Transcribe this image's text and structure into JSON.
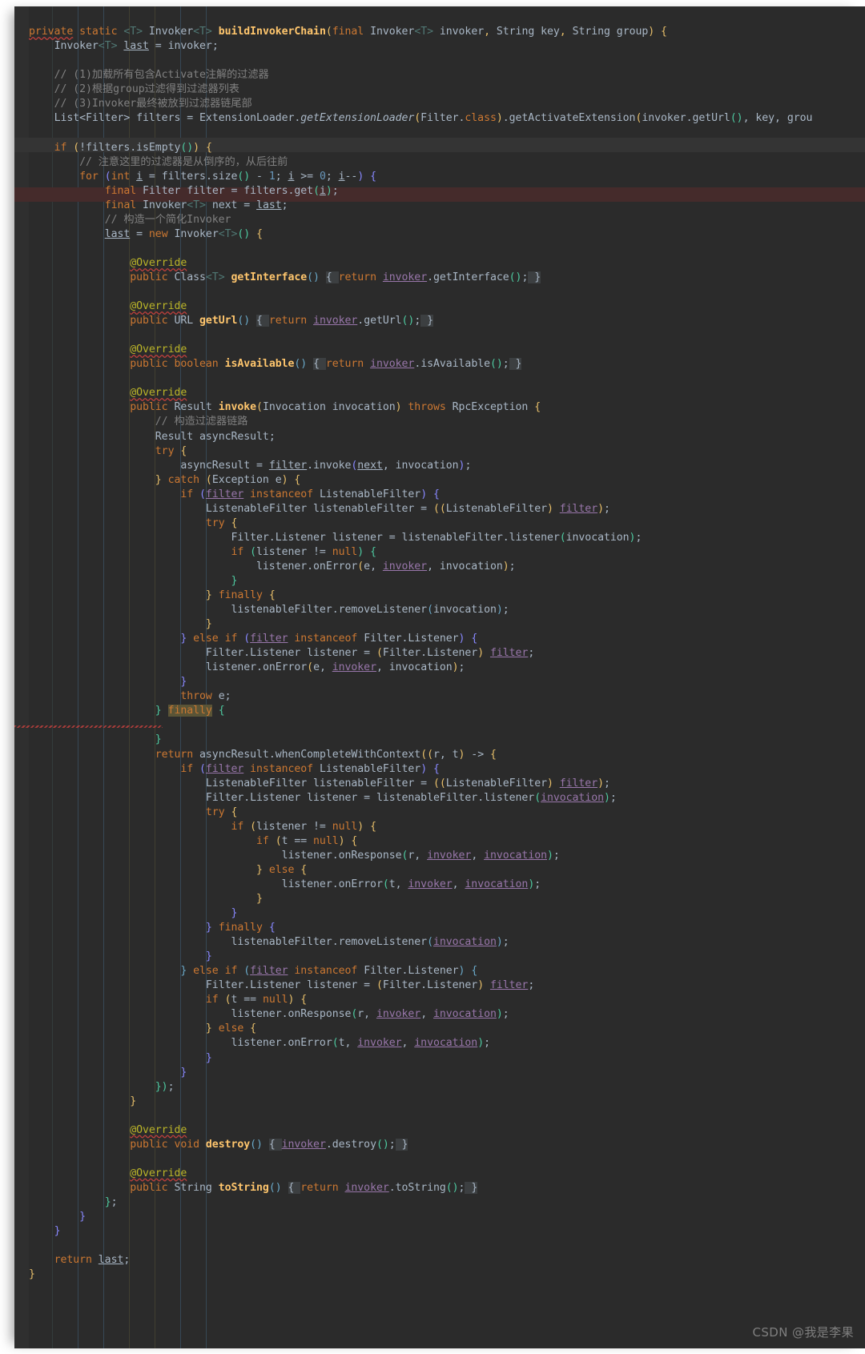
{
  "editor": {
    "language": "Java",
    "theme": "Darcula",
    "background_color": "#2b2b2b",
    "default_text_color": "#a9b7c6",
    "keyword_color": "#cc7832",
    "comment_color": "#808080",
    "annotation_color": "#bbb529",
    "field_color": "#9876aa",
    "method_color": "#ffc66d",
    "caret_line_color": "#452b2b",
    "search_match_color": "#5a5436"
  },
  "watermark": {
    "text": "CSDN @我是李果"
  },
  "code": {
    "truncated_right_edge": true,
    "lines": [
      "private static <T> Invoker<T> buildInvokerChain(final Invoker<T> invoker, String key, String group) {",
      "    Invoker<T> last = invoker;",
      "",
      "    // (1)加载所有包含Activate注解的过滤器",
      "    // (2)根据group过滤得到过滤器列表",
      "    // (3)Invoker最终被放到过滤器链尾部",
      "    List<Filter> filters = ExtensionLoader.getExtensionLoader(Filter.class).getActivateExtension(invoker.getUrl(), key, grou",
      "",
      "    if (!filters.isEmpty()) {",
      "        // 注意这里的过滤器是从倒序的，从后往前",
      "        for (int i = filters.size() - 1; i >= 0; i--) {",
      "            final Filter filter = filters.get(i);",
      "            final Invoker<T> next = last;",
      "            // 构造一个简化Invoker",
      "            last = new Invoker<T>() {",
      "",
      "                @Override",
      "                public Class<T> getInterface() { return invoker.getInterface(); }",
      "",
      "                @Override",
      "                public URL getUrl() { return invoker.getUrl(); }",
      "",
      "                @Override",
      "                public boolean isAvailable() { return invoker.isAvailable(); }",
      "",
      "                @Override",
      "                public Result invoke(Invocation invocation) throws RpcException {",
      "                    // 构造过滤器链路",
      "                    Result asyncResult;",
      "                    try {",
      "                        asyncResult = filter.invoke(next, invocation);",
      "                    } catch (Exception e) {",
      "                        if (filter instanceof ListenableFilter) {",
      "                            ListenableFilter listenableFilter = ((ListenableFilter) filter);",
      "                            try {",
      "                                Filter.Listener listener = listenableFilter.listener(invocation);",
      "                                if (listener != null) {",
      "                                    listener.onError(e, invoker, invocation);",
      "                                }",
      "                            } finally {",
      "                                listenableFilter.removeListener(invocation);",
      "                            }",
      "                        } else if (filter instanceof Filter.Listener) {",
      "                            Filter.Listener listener = (Filter.Listener) filter;",
      "                            listener.onError(e, invoker, invocation);",
      "                        }",
      "                        throw e;",
      "                    } finally {",
      "",
      "                    }",
      "                    return asyncResult.whenCompleteWithContext((r, t) -> {",
      "                        if (filter instanceof ListenableFilter) {",
      "                            ListenableFilter listenableFilter = ((ListenableFilter) filter);",
      "                            Filter.Listener listener = listenableFilter.listener(invocation);",
      "                            try {",
      "                                if (listener != null) {",
      "                                    if (t == null) {",
      "                                        listener.onResponse(r, invoker, invocation);",
      "                                    } else {",
      "                                        listener.onError(t, invoker, invocation);",
      "                                    }",
      "                                }",
      "                            } finally {",
      "                                listenableFilter.removeListener(invocation);",
      "                            }",
      "                        } else if (filter instanceof Filter.Listener) {",
      "                            Filter.Listener listener = (Filter.Listener) filter;",
      "                            if (t == null) {",
      "                                listener.onResponse(r, invoker, invocation);",
      "                            } else {",
      "                                listener.onError(t, invoker, invocation);",
      "                            }",
      "                        }",
      "                    });",
      "                }",
      "",
      "                @Override",
      "                public void destroy() { invoker.destroy(); }",
      "",
      "                @Override",
      "                public String toString() { return invoker.toString(); }",
      "            };",
      "        }",
      "    }",
      "",
      "    return last;",
      "}"
    ],
    "highlighted_keyword": "finally",
    "caret_line_text": "            final Invoker<T> next = last;"
  }
}
